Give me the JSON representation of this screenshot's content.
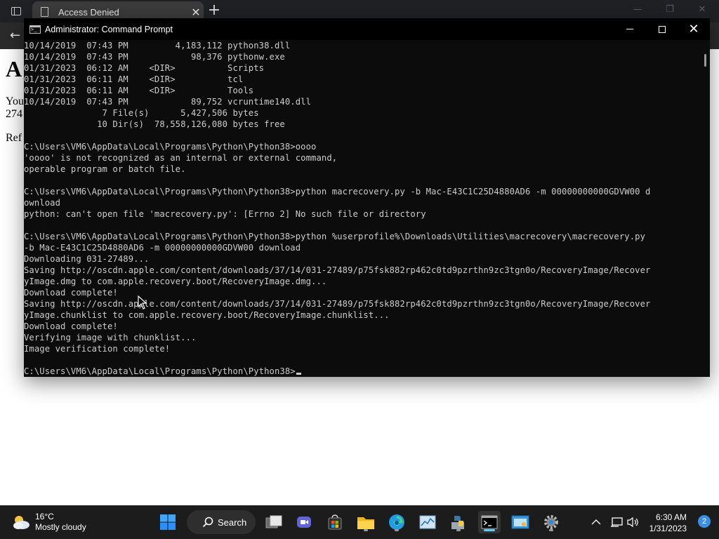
{
  "browser": {
    "tab_title": "Access Denied",
    "page": {
      "heading": "A",
      "line1": "You",
      "line2": "274",
      "line3": "Ref"
    }
  },
  "cmd": {
    "title": "Administrator: Command Prompt",
    "lines": [
      "10/14/2019  07:43 PM         4,183,112 python38.dll",
      "10/14/2019  07:43 PM            98,376 pythonw.exe",
      "01/31/2023  06:12 AM    <DIR>          Scripts",
      "01/31/2023  06:11 AM    <DIR>          tcl",
      "01/31/2023  06:11 AM    <DIR>          Tools",
      "10/14/2019  07:43 PM            89,752 vcruntime140.dll",
      "               7 File(s)      5,427,506 bytes",
      "              10 Dir(s)  78,558,126,080 bytes free",
      "",
      "C:\\Users\\VM6\\AppData\\Local\\Programs\\Python\\Python38>oooo",
      "'oooo' is not recognized as an internal or external command,",
      "operable program or batch file.",
      "",
      "C:\\Users\\VM6\\AppData\\Local\\Programs\\Python\\Python38>python macrecovery.py -b Mac-E43C1C25D4880AD6 -m 00000000000GDVW00 d",
      "ownload",
      "python: can't open file 'macrecovery.py': [Errno 2] No such file or directory",
      "",
      "C:\\Users\\VM6\\AppData\\Local\\Programs\\Python\\Python38>python %userprofile%\\Downloads\\Utilities\\macrecovery\\macrecovery.py",
      "-b Mac-E43C1C25D4880AD6 -m 00000000000GDVW00 download",
      "Downloading 031-27489...",
      "Saving http://oscdn.apple.com/content/downloads/37/14/031-27489/p75fsk882rp462c0td9pzrthn9zc3tgn0o/RecoveryImage/Recover",
      "yImage.dmg to com.apple.recovery.boot/RecoveryImage.dmg...",
      "Download complete!",
      "Saving http://oscdn.apple.com/content/downloads/37/14/031-27489/p75fsk882rp462c0td9pzrthn9zc3tgn0o/RecoveryImage/Recover",
      "yImage.chunklist to com.apple.recovery.boot/RecoveryImage.chunklist...",
      "Download complete!",
      "Verifying image with chunklist...",
      "Image verification complete!",
      ""
    ],
    "prompt": "C:\\Users\\VM6\\AppData\\Local\\Programs\\Python\\Python38>"
  },
  "taskbar": {
    "weather": {
      "temp": "16°C",
      "condition": "Mostly cloudy"
    },
    "search_label": "Search",
    "clock": {
      "time": "6:30 AM",
      "date": "1/31/2023"
    },
    "notification_count": "2"
  },
  "colors": {
    "console_bg": "#0c0c0c",
    "console_text": "#cccccc",
    "taskbar_bg": "#1c1c1c",
    "accent": "#60cdff"
  }
}
